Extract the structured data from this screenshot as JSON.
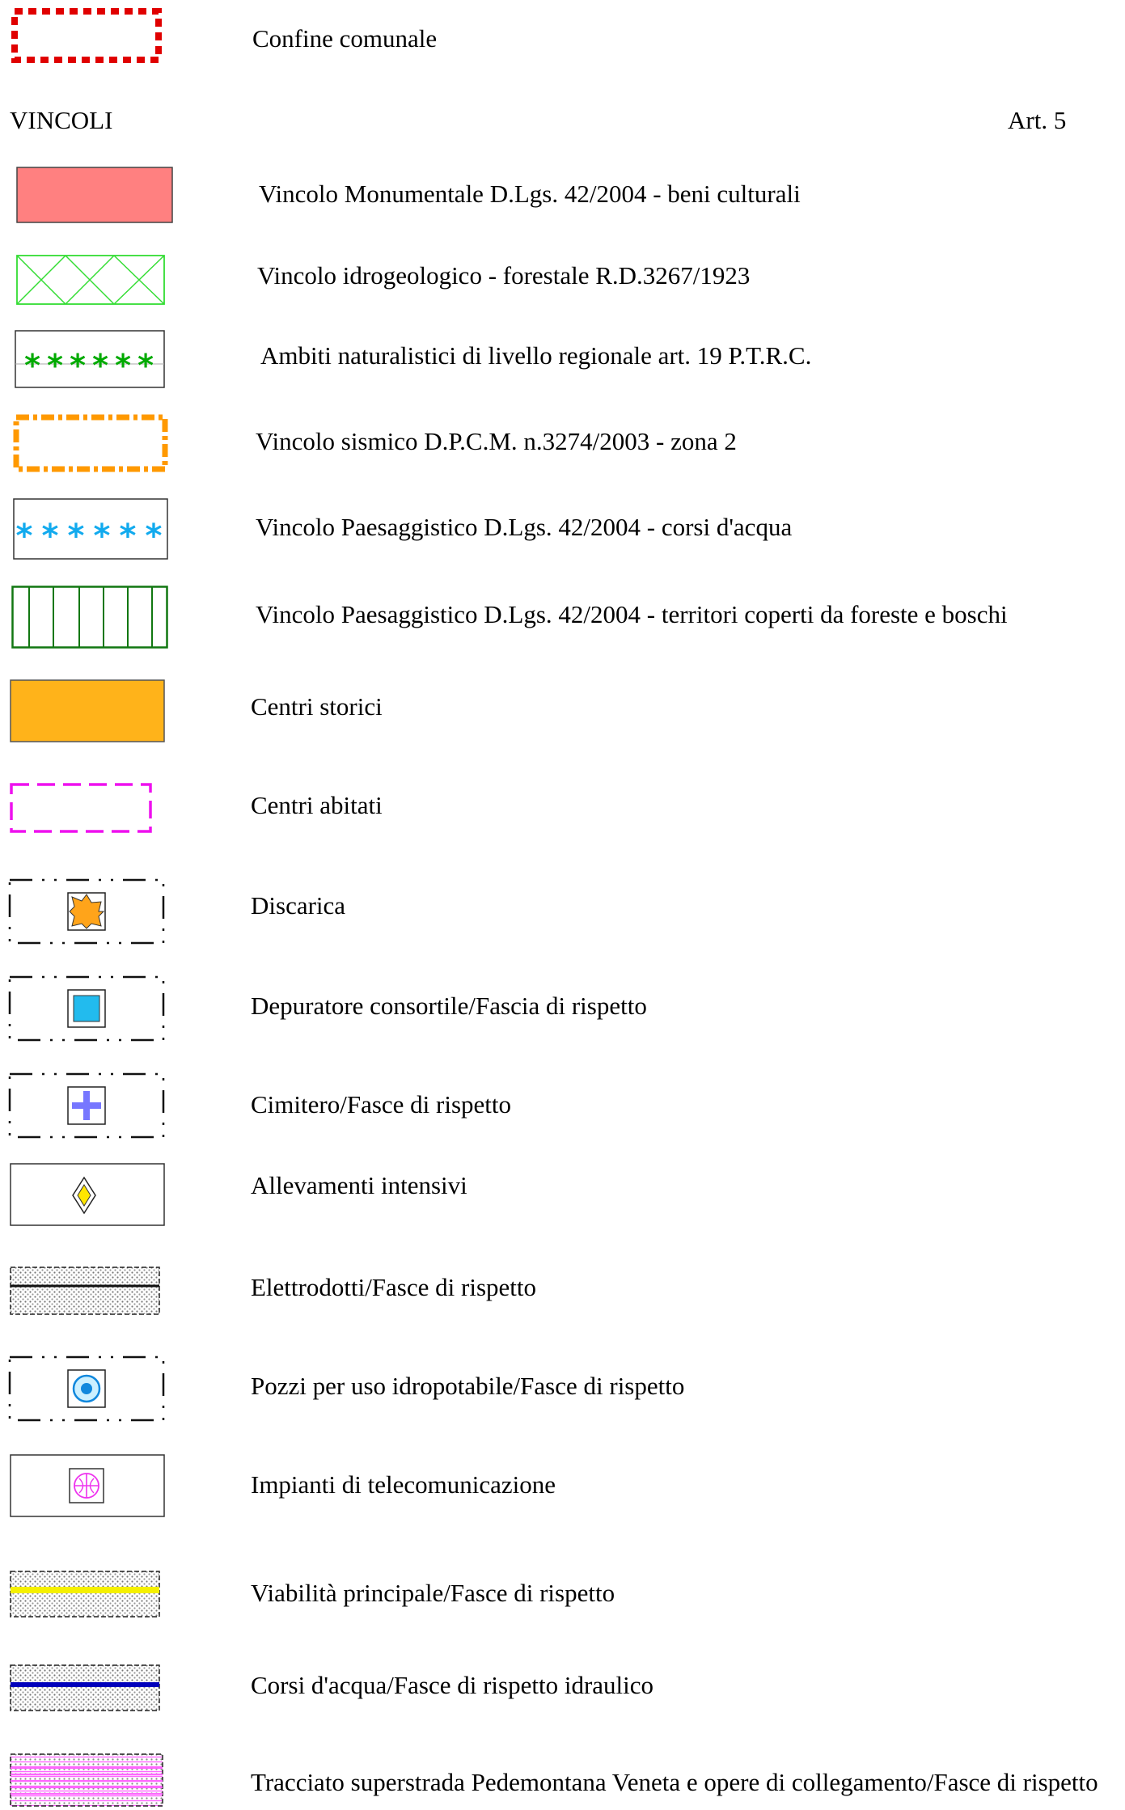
{
  "header_item": {
    "label": "Confine comunale",
    "symbol": "red-dotted-border"
  },
  "section": {
    "title": "VINCOLI",
    "article": "Art.  5"
  },
  "items": [
    {
      "label": "Vincolo Monumentale D.Lgs. 42/2004 - beni culturali",
      "symbol": "salmon-fill"
    },
    {
      "label": "Vincolo idrogeologico - forestale R.D.3267/1923",
      "symbol": "green-crosshatch"
    },
    {
      "label": "Ambiti naturalistici di livello regionale art. 19 P.T.R.C.",
      "symbol": "green-asterisks"
    },
    {
      "label": "Vincolo sismico D.P.C.M. n.3274/2003 - zona 2",
      "symbol": "orange-dashdot-border"
    },
    {
      "label": "Vincolo Paesaggistico D.Lgs. 42/2004 - corsi d'acqua",
      "symbol": "cyan-asterisks"
    },
    {
      "label": "Vincolo Paesaggistico D.Lgs. 42/2004 - territori coperti da foreste e boschi",
      "symbol": "green-vertical-stripes"
    },
    {
      "label": "Centri storici",
      "symbol": "orange-fill"
    },
    {
      "label": "Centri abitati",
      "symbol": "magenta-dashed-border"
    },
    {
      "label": "Discarica",
      "symbol": "orange-star-icon"
    },
    {
      "label": "Depuratore consortile/Fascia di rispetto",
      "symbol": "cyan-square-icon"
    },
    {
      "label": "Cimitero/Fasce di rispetto",
      "symbol": "blue-cross-icon"
    },
    {
      "label": "Allevamenti intensivi",
      "symbol": "yellow-diamond-icon"
    },
    {
      "label": "Elettrodotti/Fasce di rispetto",
      "symbol": "power-line-band"
    },
    {
      "label": "Pozzi per uso idropotabile/Fasce di rispetto",
      "symbol": "well-circle-icon"
    },
    {
      "label": "Impianti di telecomunicazione",
      "symbol": "antenna-icon"
    },
    {
      "label": "Viabilità principale/Fasce di rispetto",
      "symbol": "yellow-road-band"
    },
    {
      "label": "Corsi d'acqua/Fasce di rispetto idraulico",
      "symbol": "blue-water-band"
    },
    {
      "label": "Tracciato superstrada Pedemontana Veneta e opere di collegamento/Fasce di rispetto",
      "symbol": "pink-road-band"
    }
  ],
  "colors": {
    "municipal_border": "#e00000",
    "monumental": "#ff8080",
    "hydro_green": "#33dd33",
    "natural_green": "#00aa00",
    "seismic_orange": "#ff9900",
    "water_cyan": "#11aaee",
    "forest_green": "#117711",
    "historic_orange": "#ffb31a",
    "inhabited_magenta": "#ee11ee",
    "cemetery_blue": "#7777ff",
    "road_yellow": "#f5f000",
    "stream_blue": "#0000bb",
    "highway_pink": "#ff66ff"
  }
}
